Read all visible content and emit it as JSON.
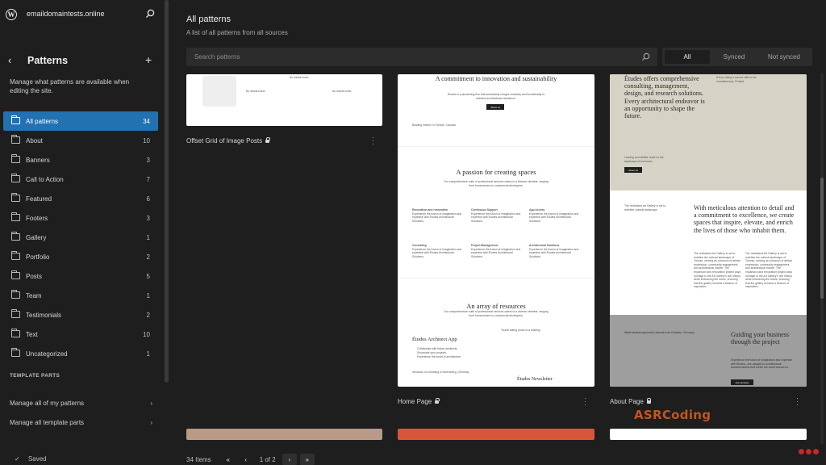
{
  "site": {
    "name": "emaildomaintests.online"
  },
  "sidebar": {
    "title": "Patterns",
    "description": "Manage what patterns are available when editing the site.",
    "items": [
      {
        "label": "All patterns",
        "count": "34",
        "active": true
      },
      {
        "label": "About",
        "count": "10"
      },
      {
        "label": "Banners",
        "count": "3"
      },
      {
        "label": "Call to Action",
        "count": "7"
      },
      {
        "label": "Featured",
        "count": "6"
      },
      {
        "label": "Footers",
        "count": "3"
      },
      {
        "label": "Gallery",
        "count": "1"
      },
      {
        "label": "Portfolio",
        "count": "2"
      },
      {
        "label": "Posts",
        "count": "5"
      },
      {
        "label": "Team",
        "count": "1"
      },
      {
        "label": "Testimonials",
        "count": "2"
      },
      {
        "label": "Text",
        "count": "10"
      },
      {
        "label": "Uncategorized",
        "count": "1"
      }
    ],
    "template_parts_heading": "TEMPLATE PARTS",
    "manage_patterns": "Manage all of my patterns",
    "manage_template_parts": "Manage all template parts",
    "saved": "Saved"
  },
  "main": {
    "title": "All patterns",
    "subtitle": "A list of all patterns from all sources",
    "search_placeholder": "Search patterns",
    "filters": [
      "All",
      "Synced",
      "Not synced"
    ],
    "cards": {
      "offset_grid": {
        "label": "Offset Grid of Image Posts",
        "no_results": "No results found."
      },
      "home_page": {
        "label": "Home Page",
        "heading1": "A commitment to innovation and sustainability",
        "blurb1": "Études is a pioneering firm that seamlessly merges creativity and functionality to redefine architectural excellence.",
        "about_btn": "About us",
        "caption1": "Building exterior in Toronto, Canada",
        "heading2": "A passion for creating spaces",
        "blurb2": "Our comprehensive suite of professional services caters to a diverse clientele, ranging from homeowners to commercial developers.",
        "services": [
          {
            "title": "Renovation and restoration",
            "text": "Experience the fusion of imagination and expertise with Études Architectural Solutions."
          },
          {
            "title": "Continuous Support",
            "text": "Experience the fusion of imagination and expertise with Études Architectural Solutions."
          },
          {
            "title": "App Access",
            "text": "Experience the fusion of imagination and expertise with Études Architectural Solutions."
          },
          {
            "title": "Consulting",
            "text": "Experience the fusion of imagination and expertise with Études Architectural Solutions."
          },
          {
            "title": "Project Management",
            "text": "Experience the fusion of imagination and expertise with Études Architectural Solutions."
          },
          {
            "title": "Architectural Solutions",
            "text": "Experience the fusion of imagination and expertise with Études Architectural Solutions."
          }
        ],
        "heading3": "An array of resources",
        "blurb3": "Our comprehensive suite of professional services caters to a diverse clientele, ranging from homeowners to commercial developers.",
        "app_title": "Études Architect App",
        "app_items": [
          "Collaborate with fellow architects.",
          "Showcase your projects.",
          "Experience the world of architecture."
        ],
        "caption2": "Tourist taking photo of a building",
        "caption3": "Windows of a building in Nuremberg, Germany",
        "newsletter": "Études Newsletter"
      },
      "about_page": {
        "label": "About Page",
        "heading1": "Études offers comprehensive consulting, management, design, and research solutions. Every architectural endeavor is an opportunity to shape the future.",
        "caption1": "A ferry riding a current with in the mountaineous, Finland",
        "caption2": "Leaving an indelible mark on the landscape of tomorrow.",
        "btn": "About us",
        "heading2": "With meticulous attention to detail and a commitment to excellence, we create spaces that inspire, elevate, and enrich the lives of those who inhabit them.",
        "side_text": "The revitalized art Gallery is set to redefine cultural landscape.",
        "para": "The revitalized Art Gallery is set to redefine the cultural landscape of Toronto, serving as a beacon of artistic expression, community engagement, and architectural marvel. The expansion and renovation project pays homage to the Art Gallery's rich history while embracing the future, ensuring that the gallery remains a beacon of inspiration.",
        "heading3": "Guiding your business through the project",
        "blurb3": "Experience the fusion of imagination and expertise with Études—the catalyst for architectural transformations that enrich the world around us.",
        "caption3": "White abstract geometric artwork from Dresden, Germany",
        "btn3": "Our services"
      }
    },
    "pagination": {
      "items": "34 Items",
      "first": "«",
      "prev": "‹",
      "current": "1 of 2",
      "next": "›",
      "last": "»"
    }
  },
  "watermark": "ASRCoding"
}
